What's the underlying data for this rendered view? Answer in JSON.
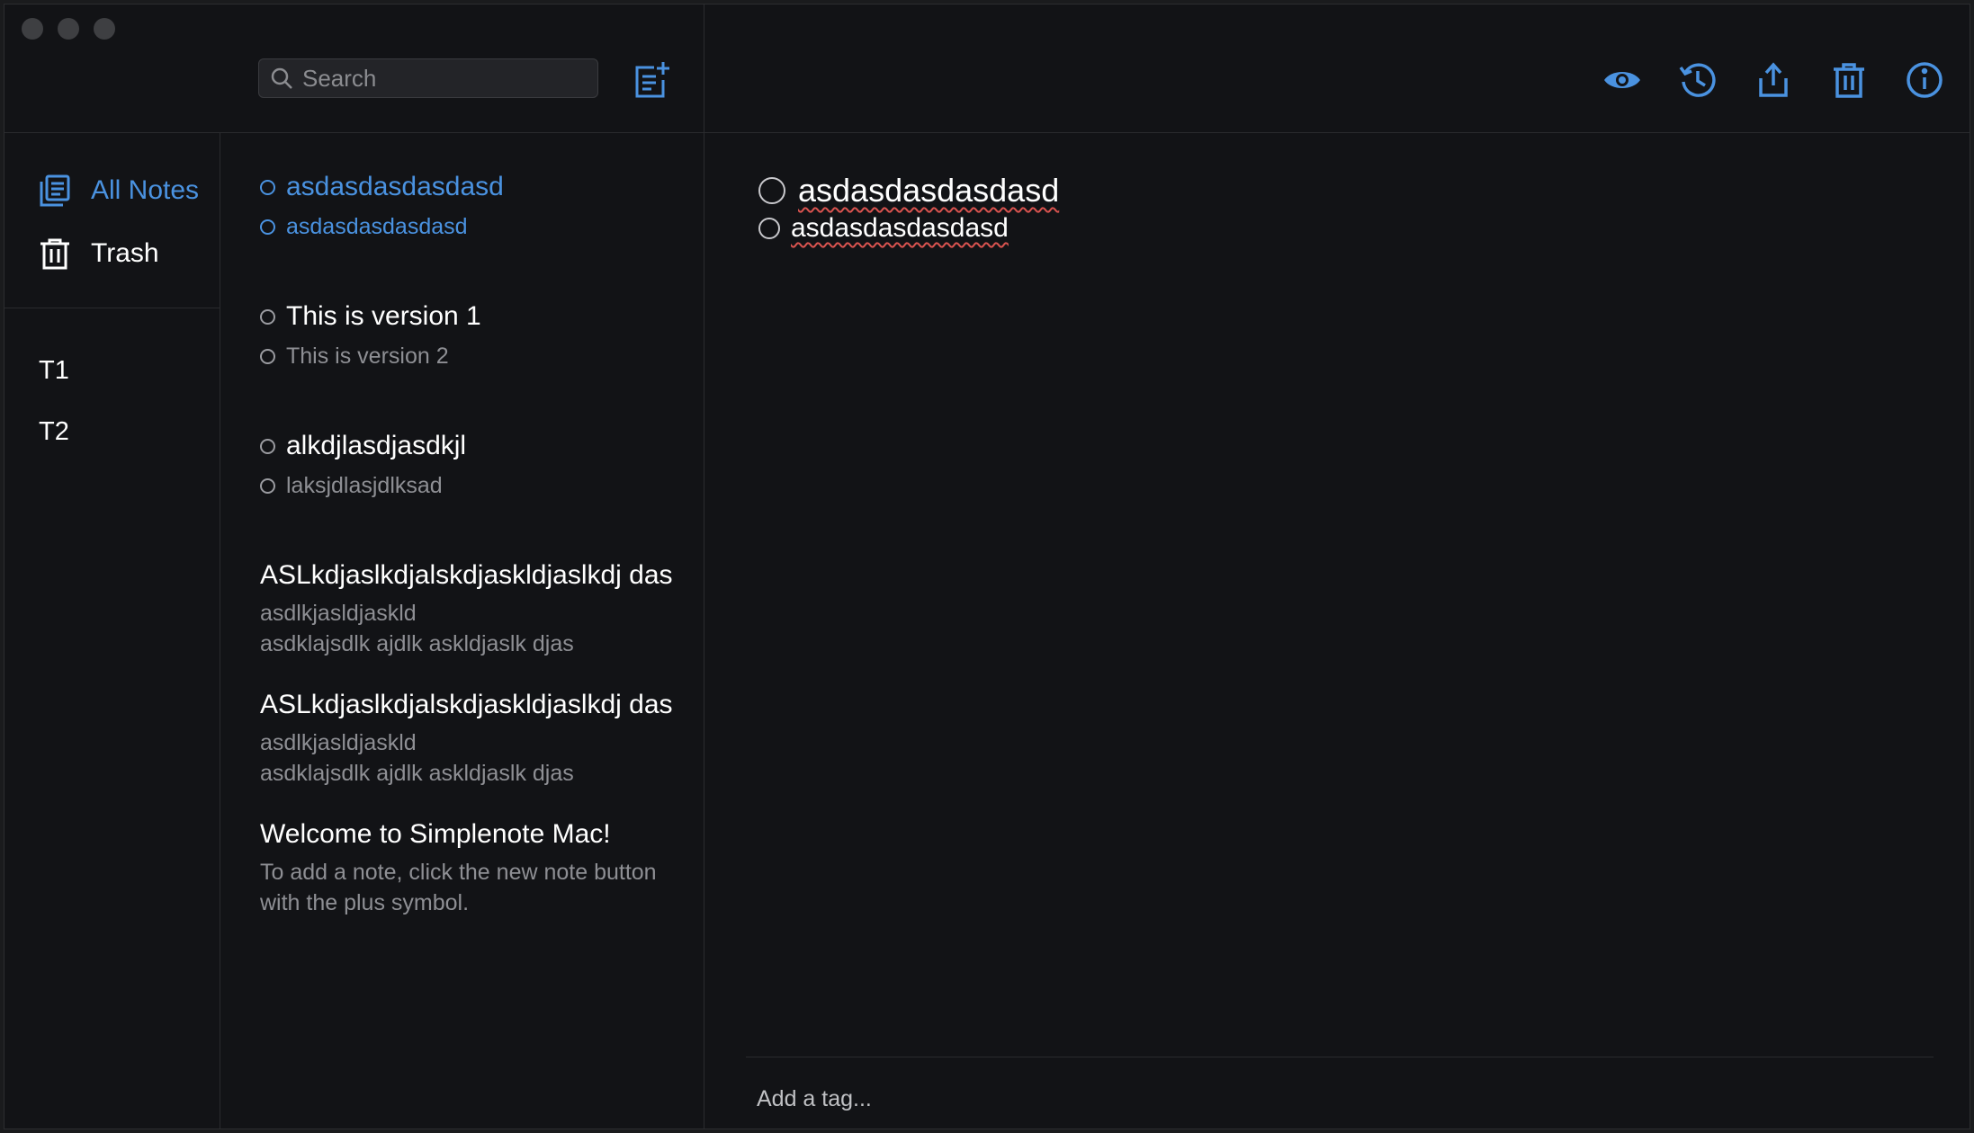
{
  "window": {
    "traffic_lights": [
      "close",
      "minimize",
      "zoom"
    ]
  },
  "sidebar": {
    "nav": [
      {
        "label": "All Notes",
        "icon": "all-notes-icon",
        "active": true
      },
      {
        "label": "Trash",
        "icon": "trash-icon",
        "active": false
      }
    ],
    "tags": [
      "T1",
      "T2"
    ]
  },
  "list": {
    "search_placeholder": "Search",
    "new_note_icon": "new-note-icon",
    "notes": [
      {
        "title": "asdasdasdasdasd",
        "lines": [
          "asdasdasdasdasd"
        ],
        "checklist": true,
        "selected": true
      },
      {
        "title": "This is version 1",
        "lines": [
          "This is version 2"
        ],
        "checklist": true,
        "selected": false
      },
      {
        "title": "alkdjlasdjasdkjl",
        "lines": [
          "laksjdlasjdlksad"
        ],
        "checklist": true,
        "selected": false
      },
      {
        "title": "ASLkdjaslkdjalskdjaskldjaslkdj das",
        "lines": [
          "asdlkjasldjaskld",
          "asdklajsdlk ajdlk askldjaslk djas"
        ],
        "checklist": false,
        "selected": false
      },
      {
        "title": "ASLkdjaslkdjalskdjaskldjaslkdj das",
        "lines": [
          "asdlkjasldjaskld",
          "asdklajsdlk ajdlk askldjaslk djas"
        ],
        "checklist": false,
        "selected": false
      },
      {
        "title": "Welcome to Simplenote Mac!",
        "lines": [
          "To add a note, click the new note button",
          "with the plus symbol."
        ],
        "checklist": false,
        "selected": false
      }
    ]
  },
  "toolbar": {
    "icons": [
      "preview-icon",
      "history-icon",
      "share-icon",
      "trash-icon",
      "info-icon"
    ]
  },
  "editor": {
    "line1": "asdasdasdasdasd",
    "line2": "asdasdasdasdasd",
    "tag_placeholder": "Add a tag..."
  },
  "colors": {
    "accent": "#4a92e0",
    "background": "#121316",
    "muted_text": "#8e8f94"
  }
}
